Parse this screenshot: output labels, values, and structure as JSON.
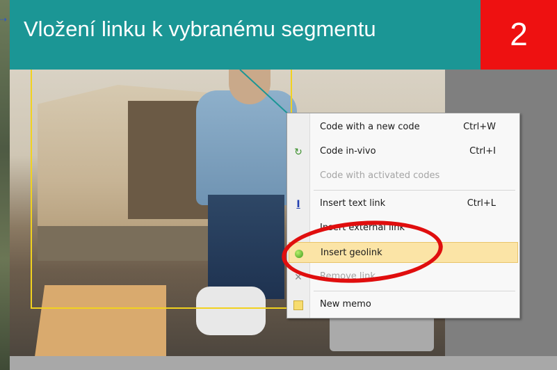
{
  "slide": {
    "title": "Vložení linku k vybranému segmentu",
    "number": "2"
  },
  "context_menu": {
    "items": [
      {
        "label": "Code with a new code",
        "shortcut": "Ctrl+W",
        "icon": "none",
        "enabled": true
      },
      {
        "label": "Code in-vivo",
        "shortcut": "Ctrl+I",
        "icon": "in-vivo-code-icon",
        "enabled": true
      },
      {
        "label": "Code with activated codes",
        "shortcut": "",
        "icon": "none",
        "enabled": false
      },
      {
        "label": "Insert text link",
        "shortcut": "Ctrl+L",
        "icon": "text-link-icon",
        "enabled": true
      },
      {
        "label": "Insert external link",
        "shortcut": "",
        "icon": "none",
        "enabled": true
      },
      {
        "label": "Insert geolink",
        "shortcut": "",
        "icon": "geolink-green-dot-icon",
        "enabled": true,
        "highlighted": true
      },
      {
        "label": "Remove link",
        "shortcut": "",
        "icon": "remove-x-icon",
        "enabled": false
      },
      {
        "label": "New memo",
        "shortcut": "",
        "icon": "memo-note-icon",
        "enabled": true
      }
    ]
  },
  "colors": {
    "header_bg": "#1b9695",
    "badge_bg": "#ee1111",
    "highlight_bg": "#fbe4a6",
    "annotation_red": "#e00e0e"
  }
}
